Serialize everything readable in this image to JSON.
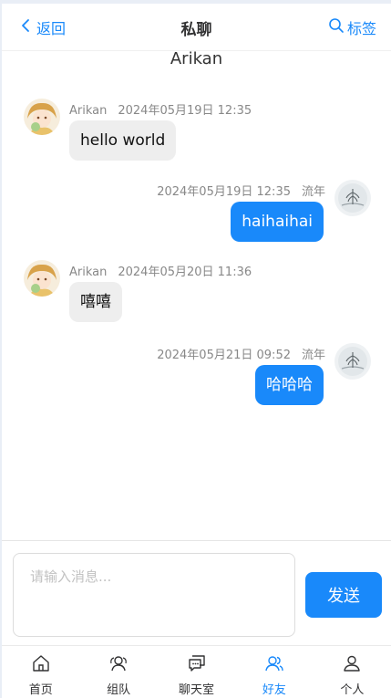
{
  "header": {
    "back_label": "返回",
    "title": "私聊",
    "right_label": "标签"
  },
  "chat_name": "Arikan",
  "messages": [
    {
      "side": "left",
      "sender": "Arikan",
      "time": "2024年05月19日 12:35",
      "text": "hello world"
    },
    {
      "side": "right",
      "sender": "流年",
      "time": "2024年05月19日 12:35",
      "text": "haihaihai"
    },
    {
      "side": "left",
      "sender": "Arikan",
      "time": "2024年05月20日 11:36",
      "text": "嘻嘻"
    },
    {
      "side": "right",
      "sender": "流年",
      "time": "2024年05月21日 09:52",
      "text": "哈哈哈"
    }
  ],
  "input": {
    "placeholder": "请输入消息...",
    "value": "",
    "send_label": "发送"
  },
  "tabbar": [
    {
      "label": "首页",
      "icon": "home-icon",
      "active": false
    },
    {
      "label": "组队",
      "icon": "team-icon",
      "active": false
    },
    {
      "label": "聊天室",
      "icon": "chat-room-icon",
      "active": false
    },
    {
      "label": "好友",
      "icon": "friends-icon",
      "active": true
    },
    {
      "label": "个人",
      "icon": "user-icon",
      "active": false
    }
  ],
  "colors": {
    "accent": "#1989fa",
    "bubble_left": "#eeeeee",
    "page_bg": "#e9eef6"
  }
}
